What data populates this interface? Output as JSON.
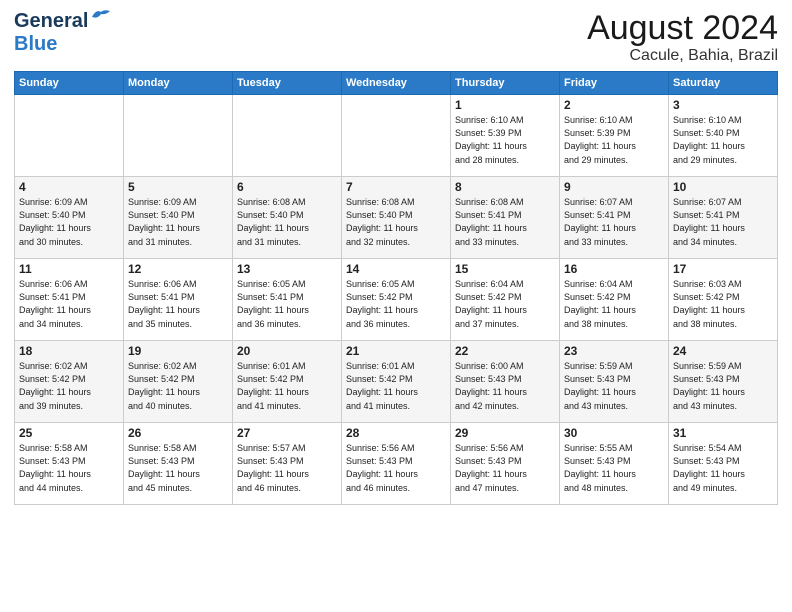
{
  "header": {
    "logo_general": "General",
    "logo_blue": "Blue",
    "title": "August 2024",
    "subtitle": "Cacule, Bahia, Brazil"
  },
  "weekdays": [
    "Sunday",
    "Monday",
    "Tuesday",
    "Wednesday",
    "Thursday",
    "Friday",
    "Saturday"
  ],
  "weeks": [
    [
      {
        "num": "",
        "content": ""
      },
      {
        "num": "",
        "content": ""
      },
      {
        "num": "",
        "content": ""
      },
      {
        "num": "",
        "content": ""
      },
      {
        "num": "1",
        "content": "Sunrise: 6:10 AM\nSunset: 5:39 PM\nDaylight: 11 hours\nand 28 minutes."
      },
      {
        "num": "2",
        "content": "Sunrise: 6:10 AM\nSunset: 5:39 PM\nDaylight: 11 hours\nand 29 minutes."
      },
      {
        "num": "3",
        "content": "Sunrise: 6:10 AM\nSunset: 5:40 PM\nDaylight: 11 hours\nand 29 minutes."
      }
    ],
    [
      {
        "num": "4",
        "content": "Sunrise: 6:09 AM\nSunset: 5:40 PM\nDaylight: 11 hours\nand 30 minutes."
      },
      {
        "num": "5",
        "content": "Sunrise: 6:09 AM\nSunset: 5:40 PM\nDaylight: 11 hours\nand 31 minutes."
      },
      {
        "num": "6",
        "content": "Sunrise: 6:08 AM\nSunset: 5:40 PM\nDaylight: 11 hours\nand 31 minutes."
      },
      {
        "num": "7",
        "content": "Sunrise: 6:08 AM\nSunset: 5:40 PM\nDaylight: 11 hours\nand 32 minutes."
      },
      {
        "num": "8",
        "content": "Sunrise: 6:08 AM\nSunset: 5:41 PM\nDaylight: 11 hours\nand 33 minutes."
      },
      {
        "num": "9",
        "content": "Sunrise: 6:07 AM\nSunset: 5:41 PM\nDaylight: 11 hours\nand 33 minutes."
      },
      {
        "num": "10",
        "content": "Sunrise: 6:07 AM\nSunset: 5:41 PM\nDaylight: 11 hours\nand 34 minutes."
      }
    ],
    [
      {
        "num": "11",
        "content": "Sunrise: 6:06 AM\nSunset: 5:41 PM\nDaylight: 11 hours\nand 34 minutes."
      },
      {
        "num": "12",
        "content": "Sunrise: 6:06 AM\nSunset: 5:41 PM\nDaylight: 11 hours\nand 35 minutes."
      },
      {
        "num": "13",
        "content": "Sunrise: 6:05 AM\nSunset: 5:41 PM\nDaylight: 11 hours\nand 36 minutes."
      },
      {
        "num": "14",
        "content": "Sunrise: 6:05 AM\nSunset: 5:42 PM\nDaylight: 11 hours\nand 36 minutes."
      },
      {
        "num": "15",
        "content": "Sunrise: 6:04 AM\nSunset: 5:42 PM\nDaylight: 11 hours\nand 37 minutes."
      },
      {
        "num": "16",
        "content": "Sunrise: 6:04 AM\nSunset: 5:42 PM\nDaylight: 11 hours\nand 38 minutes."
      },
      {
        "num": "17",
        "content": "Sunrise: 6:03 AM\nSunset: 5:42 PM\nDaylight: 11 hours\nand 38 minutes."
      }
    ],
    [
      {
        "num": "18",
        "content": "Sunrise: 6:02 AM\nSunset: 5:42 PM\nDaylight: 11 hours\nand 39 minutes."
      },
      {
        "num": "19",
        "content": "Sunrise: 6:02 AM\nSunset: 5:42 PM\nDaylight: 11 hours\nand 40 minutes."
      },
      {
        "num": "20",
        "content": "Sunrise: 6:01 AM\nSunset: 5:42 PM\nDaylight: 11 hours\nand 41 minutes."
      },
      {
        "num": "21",
        "content": "Sunrise: 6:01 AM\nSunset: 5:42 PM\nDaylight: 11 hours\nand 41 minutes."
      },
      {
        "num": "22",
        "content": "Sunrise: 6:00 AM\nSunset: 5:43 PM\nDaylight: 11 hours\nand 42 minutes."
      },
      {
        "num": "23",
        "content": "Sunrise: 5:59 AM\nSunset: 5:43 PM\nDaylight: 11 hours\nand 43 minutes."
      },
      {
        "num": "24",
        "content": "Sunrise: 5:59 AM\nSunset: 5:43 PM\nDaylight: 11 hours\nand 43 minutes."
      }
    ],
    [
      {
        "num": "25",
        "content": "Sunrise: 5:58 AM\nSunset: 5:43 PM\nDaylight: 11 hours\nand 44 minutes."
      },
      {
        "num": "26",
        "content": "Sunrise: 5:58 AM\nSunset: 5:43 PM\nDaylight: 11 hours\nand 45 minutes."
      },
      {
        "num": "27",
        "content": "Sunrise: 5:57 AM\nSunset: 5:43 PM\nDaylight: 11 hours\nand 46 minutes."
      },
      {
        "num": "28",
        "content": "Sunrise: 5:56 AM\nSunset: 5:43 PM\nDaylight: 11 hours\nand 46 minutes."
      },
      {
        "num": "29",
        "content": "Sunrise: 5:56 AM\nSunset: 5:43 PM\nDaylight: 11 hours\nand 47 minutes."
      },
      {
        "num": "30",
        "content": "Sunrise: 5:55 AM\nSunset: 5:43 PM\nDaylight: 11 hours\nand 48 minutes."
      },
      {
        "num": "31",
        "content": "Sunrise: 5:54 AM\nSunset: 5:43 PM\nDaylight: 11 hours\nand 49 minutes."
      }
    ]
  ]
}
